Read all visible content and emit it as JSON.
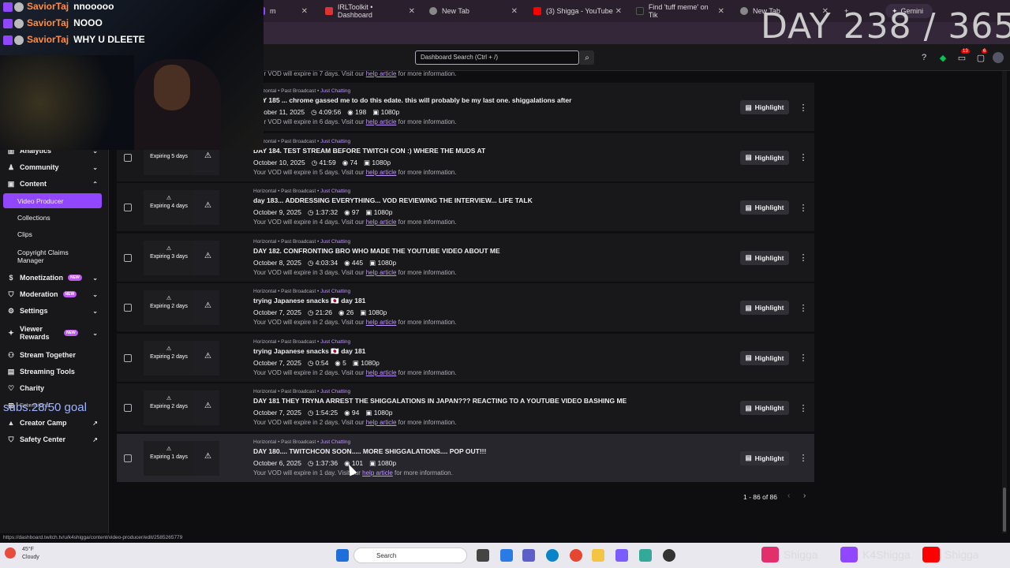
{
  "browser": {
    "tabs": [
      {
        "label": "m",
        "color": "#9147ff"
      },
      {
        "label": "IRLToolkit • Dashboard",
        "color": "#d33"
      },
      {
        "label": "New Tab",
        "color": "#888"
      },
      {
        "label": "(3) Shigga - YouTube",
        "color": "#f00"
      },
      {
        "label": "Find 'tuff meme' on Tik",
        "color": "#222"
      },
      {
        "label": "New Tab",
        "color": "#888"
      }
    ],
    "gemini_label": "Gemini"
  },
  "topnav": {
    "search_placeholder": "Dashboard Search (Ctrl + /)",
    "notif_count": "13",
    "inbox_count": "6"
  },
  "sidebar": {
    "items": [
      {
        "label": "Analytics"
      },
      {
        "label": "Community"
      },
      {
        "label": "Content"
      },
      {
        "label": "Monetization",
        "badge": "NEW"
      },
      {
        "label": "Moderation",
        "badge": "NEW"
      },
      {
        "label": "Settings"
      },
      {
        "label": "Viewer Rewards",
        "badge": "NEW"
      },
      {
        "label": "Stream Together"
      },
      {
        "label": "Streaming Tools"
      },
      {
        "label": "Charity"
      },
      {
        "label": "Extensions"
      },
      {
        "label": "Creator Camp"
      },
      {
        "label": "Safety Center"
      }
    ],
    "content_sub": [
      "Video Producer",
      "Collections",
      "Clips",
      "Copyright Claims Manager"
    ]
  },
  "top_note": {
    "pre": "Your VOD will expire in 7 days. Visit our ",
    "link": "help article",
    "post": " for more information."
  },
  "videos": [
    {
      "meta_pre": "Horizontal • Past Broadcast • ",
      "category": "Just Chatting",
      "title": "DAY 185 ... chrome gassed me to do this edate. this will probably be my last one. shiggalations after",
      "date": "October 11, 2025",
      "duration": "4:09:56",
      "views": "198",
      "quality": "1080p",
      "expiring": "Expiring 6 days",
      "note_pre": "Your VOD will expire in 6 days. Visit our ",
      "link": "help article",
      "note_post": " for more information."
    },
    {
      "meta_pre": "Horizontal • Past Broadcast • ",
      "category": "Just Chatting",
      "title": "DAY 184. TEST STREAM BEFORE TWITCH CON :) WHERE THE MUDS AT",
      "date": "October 10, 2025",
      "duration": "41:59",
      "views": "74",
      "quality": "1080p",
      "expiring": "Expiring 5 days",
      "note_pre": "Your VOD will expire in 5 days. Visit our ",
      "link": "help article",
      "note_post": " for more information."
    },
    {
      "meta_pre": "Horizontal • Past Broadcast • ",
      "category": "Just Chatting",
      "title": "day 183... ADDRESSING EVERYTHING... VOD REVIEWING THE INTERVIEW... LIFE TALK",
      "date": "October 9, 2025",
      "duration": "1:37:32",
      "views": "97",
      "quality": "1080p",
      "expiring": "Expiring 4 days",
      "note_pre": "Your VOD will expire in 4 days. Visit our ",
      "link": "help article",
      "note_post": " for more information."
    },
    {
      "meta_pre": "Horizontal • Past Broadcast • ",
      "category": "Just Chatting",
      "title": "DAY 182. CONFRONTING BRO WHO MADE THE YOUTUBE VIDEO ABOUT ME",
      "date": "October 8, 2025",
      "duration": "4:03:34",
      "views": "445",
      "quality": "1080p",
      "expiring": "Expiring 3 days",
      "note_pre": "Your VOD will expire in 3 days. Visit our ",
      "link": "help article",
      "note_post": " for more information."
    },
    {
      "meta_pre": "Horizontal • Past Broadcast • ",
      "category": "Just Chatting",
      "title": "trying Japanese snacks 🇯🇵 day 181",
      "date": "October 7, 2025",
      "duration": "21:26",
      "views": "26",
      "quality": "1080p",
      "expiring": "Expiring 2 days",
      "note_pre": "Your VOD will expire in 2 days. Visit our ",
      "link": "help article",
      "note_post": " for more information."
    },
    {
      "meta_pre": "Horizontal • Past Broadcast • ",
      "category": "Just Chatting",
      "title": "trying Japanese snacks 🇯🇵 day 181",
      "date": "October 7, 2025",
      "duration": "0:54",
      "views": "5",
      "quality": "1080p",
      "expiring": "Expiring 2 days",
      "note_pre": "Your VOD will expire in 2 days. Visit our ",
      "link": "help article",
      "note_post": " for more information."
    },
    {
      "meta_pre": "Horizontal • Past Broadcast • ",
      "category": "Just Chatting",
      "title": "DAY 181 THEY TRYNA ARREST THE SHIGGALATIONS IN JAPAN??? REACTING TO A YOUTUBE VIDEO BASHING ME",
      "date": "October 7, 2025",
      "duration": "1:54:25",
      "views": "94",
      "quality": "1080p",
      "expiring": "Expiring 2 days",
      "note_pre": "Your VOD will expire in 2 days. Visit our ",
      "link": "help article",
      "note_post": " for more information."
    },
    {
      "meta_pre": "Horizontal • Past Broadcast • ",
      "category": "Just Chatting",
      "title": "DAY 180.... TWITCHCON SOON..... MORE SHIGGALATIONS.... POP OUT!!!",
      "date": "October 6, 2025",
      "duration": "1:37:36",
      "views": "101",
      "quality": "1080p",
      "expiring": "Expiring 1 days",
      "note_pre": "Your VOD will expire in 1 day. Visit our ",
      "link": "help article",
      "note_post": " for more information."
    }
  ],
  "highlight_label": "Highlight",
  "pagination": "1 - 86 of 86",
  "status_url": "https://dashboard.twitch.tv/u/k4shigga/content/video-producer/edit/2585265779",
  "overlay": {
    "chat": [
      {
        "user": "SaviorTaj",
        "msg": "nnooooo"
      },
      {
        "user": "SaviorTaj",
        "msg": "NOOO"
      },
      {
        "user": "SaviorTaj",
        "msg": "WHY U DLEETE"
      }
    ],
    "day_counter": "DAY 238 / 365",
    "subs_goal": "subs:28/50 goal",
    "socials": [
      "Shigga",
      "K4Shigga",
      "Shigga"
    ]
  },
  "taskbar": {
    "weather_temp": "45°F",
    "weather_desc": "Cloudy",
    "search_label": "Search"
  }
}
